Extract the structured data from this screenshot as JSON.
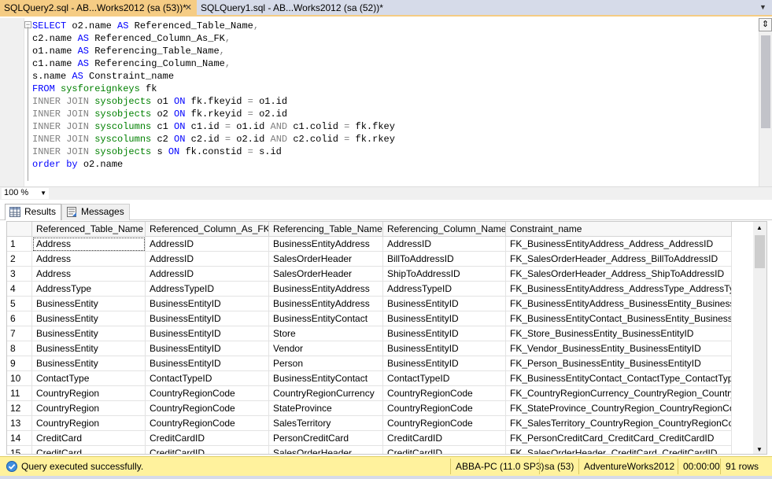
{
  "tabs": [
    {
      "label": "SQLQuery2.sql - AB...Works2012 (sa (53))*",
      "active": true
    },
    {
      "label": "SQLQuery1.sql - AB...Works2012 (sa (52))*",
      "active": false
    }
  ],
  "editor": {
    "lines": [
      [
        {
          "t": "kw",
          "v": "SELECT "
        },
        {
          "t": "pl",
          "v": "o2.name "
        },
        {
          "t": "kw",
          "v": "AS "
        },
        {
          "t": "pl",
          "v": "Referenced_Table_Name"
        },
        {
          "t": "gr",
          "v": ","
        }
      ],
      [
        {
          "t": "pl",
          "v": "c2.name "
        },
        {
          "t": "kw",
          "v": "AS "
        },
        {
          "t": "pl",
          "v": "Referenced_Column_As_FK"
        },
        {
          "t": "gr",
          "v": ","
        }
      ],
      [
        {
          "t": "pl",
          "v": "o1.name "
        },
        {
          "t": "kw",
          "v": "AS "
        },
        {
          "t": "pl",
          "v": "Referencing_Table_Name"
        },
        {
          "t": "gr",
          "v": ","
        }
      ],
      [
        {
          "t": "pl",
          "v": "c1.name "
        },
        {
          "t": "kw",
          "v": "AS "
        },
        {
          "t": "pl",
          "v": "Referencing_Column_Name"
        },
        {
          "t": "gr",
          "v": ","
        }
      ],
      [
        {
          "t": "pl",
          "v": "s.name "
        },
        {
          "t": "kw",
          "v": "AS "
        },
        {
          "t": "pl",
          "v": "Constraint_name"
        }
      ],
      [
        {
          "t": "kw",
          "v": "FROM "
        },
        {
          "t": "fn",
          "v": "sysforeignkeys "
        },
        {
          "t": "pl",
          "v": "fk"
        }
      ],
      [
        {
          "t": "gr",
          "v": "INNER JOIN "
        },
        {
          "t": "fn",
          "v": "sysobjects "
        },
        {
          "t": "pl",
          "v": "o1 "
        },
        {
          "t": "kw",
          "v": "ON "
        },
        {
          "t": "pl",
          "v": "fk.fkeyid "
        },
        {
          "t": "gr",
          "v": "= "
        },
        {
          "t": "pl",
          "v": "o1.id"
        }
      ],
      [
        {
          "t": "gr",
          "v": "INNER JOIN "
        },
        {
          "t": "fn",
          "v": "sysobjects "
        },
        {
          "t": "pl",
          "v": "o2 "
        },
        {
          "t": "kw",
          "v": "ON "
        },
        {
          "t": "pl",
          "v": "fk.rkeyid "
        },
        {
          "t": "gr",
          "v": "= "
        },
        {
          "t": "pl",
          "v": "o2.id"
        }
      ],
      [
        {
          "t": "gr",
          "v": "INNER JOIN "
        },
        {
          "t": "fn",
          "v": "syscolumns "
        },
        {
          "t": "pl",
          "v": "c1 "
        },
        {
          "t": "kw",
          "v": "ON "
        },
        {
          "t": "pl",
          "v": "c1.id "
        },
        {
          "t": "gr",
          "v": "= "
        },
        {
          "t": "pl",
          "v": "o1.id "
        },
        {
          "t": "gr",
          "v": "AND "
        },
        {
          "t": "pl",
          "v": "c1.colid "
        },
        {
          "t": "gr",
          "v": "= "
        },
        {
          "t": "pl",
          "v": "fk.fkey"
        }
      ],
      [
        {
          "t": "gr",
          "v": "INNER JOIN "
        },
        {
          "t": "fn",
          "v": "syscolumns "
        },
        {
          "t": "pl",
          "v": "c2 "
        },
        {
          "t": "kw",
          "v": "ON "
        },
        {
          "t": "pl",
          "v": "c2.id "
        },
        {
          "t": "gr",
          "v": "= "
        },
        {
          "t": "pl",
          "v": "o2.id "
        },
        {
          "t": "gr",
          "v": "AND "
        },
        {
          "t": "pl",
          "v": "c2.colid "
        },
        {
          "t": "gr",
          "v": "= "
        },
        {
          "t": "pl",
          "v": "fk.rkey"
        }
      ],
      [
        {
          "t": "gr",
          "v": "INNER JOIN "
        },
        {
          "t": "fn",
          "v": "sysobjects "
        },
        {
          "t": "pl",
          "v": "s "
        },
        {
          "t": "kw",
          "v": "ON "
        },
        {
          "t": "pl",
          "v": "fk.constid "
        },
        {
          "t": "gr",
          "v": "= "
        },
        {
          "t": "pl",
          "v": "s.id"
        }
      ],
      [
        {
          "t": "kw",
          "v": "order by "
        },
        {
          "t": "pl",
          "v": "o2.name"
        }
      ]
    ]
  },
  "zoom": {
    "value": "100 %"
  },
  "results_tabs": {
    "results": "Results",
    "messages": "Messages"
  },
  "grid": {
    "columns": [
      "",
      "Referenced_Table_Name",
      "Referenced_Column_As_FK",
      "Referencing_Table_Name",
      "Referencing_Column_Name",
      "Constraint_name"
    ],
    "rows": [
      [
        "1",
        "Address",
        "AddressID",
        "BusinessEntityAddress",
        "AddressID",
        "FK_BusinessEntityAddress_Address_AddressID"
      ],
      [
        "2",
        "Address",
        "AddressID",
        "SalesOrderHeader",
        "BillToAddressID",
        "FK_SalesOrderHeader_Address_BillToAddressID"
      ],
      [
        "3",
        "Address",
        "AddressID",
        "SalesOrderHeader",
        "ShipToAddressID",
        "FK_SalesOrderHeader_Address_ShipToAddressID"
      ],
      [
        "4",
        "AddressType",
        "AddressTypeID",
        "BusinessEntityAddress",
        "AddressTypeID",
        "FK_BusinessEntityAddress_AddressType_AddressTypeID"
      ],
      [
        "5",
        "BusinessEntity",
        "BusinessEntityID",
        "BusinessEntityAddress",
        "BusinessEntityID",
        "FK_BusinessEntityAddress_BusinessEntity_BusinessEnt..."
      ],
      [
        "6",
        "BusinessEntity",
        "BusinessEntityID",
        "BusinessEntityContact",
        "BusinessEntityID",
        "FK_BusinessEntityContact_BusinessEntity_BusinessEnti..."
      ],
      [
        "7",
        "BusinessEntity",
        "BusinessEntityID",
        "Store",
        "BusinessEntityID",
        "FK_Store_BusinessEntity_BusinessEntityID"
      ],
      [
        "8",
        "BusinessEntity",
        "BusinessEntityID",
        "Vendor",
        "BusinessEntityID",
        "FK_Vendor_BusinessEntity_BusinessEntityID"
      ],
      [
        "9",
        "BusinessEntity",
        "BusinessEntityID",
        "Person",
        "BusinessEntityID",
        "FK_Person_BusinessEntity_BusinessEntityID"
      ],
      [
        "10",
        "ContactType",
        "ContactTypeID",
        "BusinessEntityContact",
        "ContactTypeID",
        "FK_BusinessEntityContact_ContactType_ContactTypeID"
      ],
      [
        "11",
        "CountryRegion",
        "CountryRegionCode",
        "CountryRegionCurrency",
        "CountryRegionCode",
        "FK_CountryRegionCurrency_CountryRegion_CountryRe..."
      ],
      [
        "12",
        "CountryRegion",
        "CountryRegionCode",
        "StateProvince",
        "CountryRegionCode",
        "FK_StateProvince_CountryRegion_CountryRegionCode"
      ],
      [
        "13",
        "CountryRegion",
        "CountryRegionCode",
        "SalesTerritory",
        "CountryRegionCode",
        "FK_SalesTerritory_CountryRegion_CountryRegionCode"
      ],
      [
        "14",
        "CreditCard",
        "CreditCardID",
        "PersonCreditCard",
        "CreditCardID",
        "FK_PersonCreditCard_CreditCard_CreditCardID"
      ],
      [
        "15",
        "CreditCard",
        "CreditCardID",
        "SalesOrderHeader",
        "CreditCardID",
        "FK_SalesOrderHeader_CreditCard_CreditCardID"
      ]
    ]
  },
  "status": {
    "message": "Query executed successfully.",
    "server": "ABBA-PC (11.0 SP3)",
    "user": "sa (53)",
    "database": "AdventureWorks2012",
    "elapsed": "00:00:00",
    "rows": "91 rows"
  },
  "colors": {
    "accent_tab": "#f5cc84",
    "status_bar": "#fff29d",
    "keyword": "#0000ff",
    "object": "#008000",
    "operator": "#808080"
  }
}
